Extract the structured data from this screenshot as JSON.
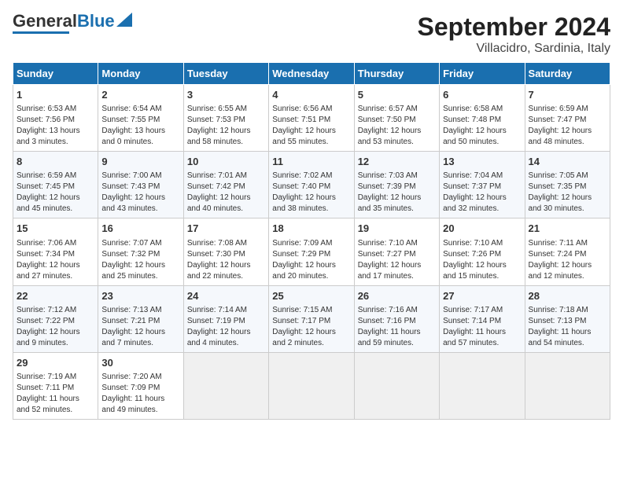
{
  "logo": {
    "text1": "General",
    "text2": "Blue"
  },
  "title": "September 2024",
  "subtitle": "Villacidro, Sardinia, Italy",
  "days_header": [
    "Sunday",
    "Monday",
    "Tuesday",
    "Wednesday",
    "Thursday",
    "Friday",
    "Saturday"
  ],
  "weeks": [
    [
      {
        "day": "1",
        "info": "Sunrise: 6:53 AM\nSunset: 7:56 PM\nDaylight: 13 hours\nand 3 minutes."
      },
      {
        "day": "2",
        "info": "Sunrise: 6:54 AM\nSunset: 7:55 PM\nDaylight: 13 hours\nand 0 minutes."
      },
      {
        "day": "3",
        "info": "Sunrise: 6:55 AM\nSunset: 7:53 PM\nDaylight: 12 hours\nand 58 minutes."
      },
      {
        "day": "4",
        "info": "Sunrise: 6:56 AM\nSunset: 7:51 PM\nDaylight: 12 hours\nand 55 minutes."
      },
      {
        "day": "5",
        "info": "Sunrise: 6:57 AM\nSunset: 7:50 PM\nDaylight: 12 hours\nand 53 minutes."
      },
      {
        "day": "6",
        "info": "Sunrise: 6:58 AM\nSunset: 7:48 PM\nDaylight: 12 hours\nand 50 minutes."
      },
      {
        "day": "7",
        "info": "Sunrise: 6:59 AM\nSunset: 7:47 PM\nDaylight: 12 hours\nand 48 minutes."
      }
    ],
    [
      {
        "day": "8",
        "info": "Sunrise: 6:59 AM\nSunset: 7:45 PM\nDaylight: 12 hours\nand 45 minutes."
      },
      {
        "day": "9",
        "info": "Sunrise: 7:00 AM\nSunset: 7:43 PM\nDaylight: 12 hours\nand 43 minutes."
      },
      {
        "day": "10",
        "info": "Sunrise: 7:01 AM\nSunset: 7:42 PM\nDaylight: 12 hours\nand 40 minutes."
      },
      {
        "day": "11",
        "info": "Sunrise: 7:02 AM\nSunset: 7:40 PM\nDaylight: 12 hours\nand 38 minutes."
      },
      {
        "day": "12",
        "info": "Sunrise: 7:03 AM\nSunset: 7:39 PM\nDaylight: 12 hours\nand 35 minutes."
      },
      {
        "day": "13",
        "info": "Sunrise: 7:04 AM\nSunset: 7:37 PM\nDaylight: 12 hours\nand 32 minutes."
      },
      {
        "day": "14",
        "info": "Sunrise: 7:05 AM\nSunset: 7:35 PM\nDaylight: 12 hours\nand 30 minutes."
      }
    ],
    [
      {
        "day": "15",
        "info": "Sunrise: 7:06 AM\nSunset: 7:34 PM\nDaylight: 12 hours\nand 27 minutes."
      },
      {
        "day": "16",
        "info": "Sunrise: 7:07 AM\nSunset: 7:32 PM\nDaylight: 12 hours\nand 25 minutes."
      },
      {
        "day": "17",
        "info": "Sunrise: 7:08 AM\nSunset: 7:30 PM\nDaylight: 12 hours\nand 22 minutes."
      },
      {
        "day": "18",
        "info": "Sunrise: 7:09 AM\nSunset: 7:29 PM\nDaylight: 12 hours\nand 20 minutes."
      },
      {
        "day": "19",
        "info": "Sunrise: 7:10 AM\nSunset: 7:27 PM\nDaylight: 12 hours\nand 17 minutes."
      },
      {
        "day": "20",
        "info": "Sunrise: 7:10 AM\nSunset: 7:26 PM\nDaylight: 12 hours\nand 15 minutes."
      },
      {
        "day": "21",
        "info": "Sunrise: 7:11 AM\nSunset: 7:24 PM\nDaylight: 12 hours\nand 12 minutes."
      }
    ],
    [
      {
        "day": "22",
        "info": "Sunrise: 7:12 AM\nSunset: 7:22 PM\nDaylight: 12 hours\nand 9 minutes."
      },
      {
        "day": "23",
        "info": "Sunrise: 7:13 AM\nSunset: 7:21 PM\nDaylight: 12 hours\nand 7 minutes."
      },
      {
        "day": "24",
        "info": "Sunrise: 7:14 AM\nSunset: 7:19 PM\nDaylight: 12 hours\nand 4 minutes."
      },
      {
        "day": "25",
        "info": "Sunrise: 7:15 AM\nSunset: 7:17 PM\nDaylight: 12 hours\nand 2 minutes."
      },
      {
        "day": "26",
        "info": "Sunrise: 7:16 AM\nSunset: 7:16 PM\nDaylight: 11 hours\nand 59 minutes."
      },
      {
        "day": "27",
        "info": "Sunrise: 7:17 AM\nSunset: 7:14 PM\nDaylight: 11 hours\nand 57 minutes."
      },
      {
        "day": "28",
        "info": "Sunrise: 7:18 AM\nSunset: 7:13 PM\nDaylight: 11 hours\nand 54 minutes."
      }
    ],
    [
      {
        "day": "29",
        "info": "Sunrise: 7:19 AM\nSunset: 7:11 PM\nDaylight: 11 hours\nand 52 minutes."
      },
      {
        "day": "30",
        "info": "Sunrise: 7:20 AM\nSunset: 7:09 PM\nDaylight: 11 hours\nand 49 minutes."
      },
      null,
      null,
      null,
      null,
      null
    ]
  ]
}
